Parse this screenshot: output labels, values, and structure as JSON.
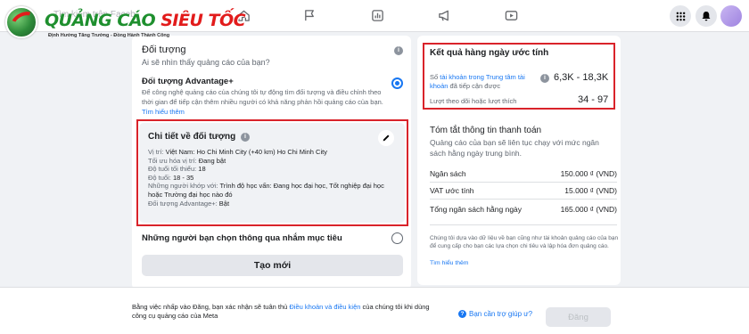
{
  "logo": {
    "text_green": "QUẢNG CÁO ",
    "text_red": "SIÊU TỐC",
    "tagline": "Định Hướng Tăng Trưởng - Đồng Hành Thành Công"
  },
  "search": {
    "placeholder": "Tìm kiếm trên Faceb"
  },
  "left": {
    "section_title": "Đối tượng",
    "section_subtitle": "Ai sẽ nhìn thấy quảng cáo của bạn?",
    "info_glyph": "i",
    "advantage_title": "Đối tượng Advantage+",
    "advantage_desc": "Để công nghệ quảng cáo của chúng tôi tự động tìm đối tượng và điều chỉnh theo thời gian để tiếp cận thêm nhiều người có khả năng phản hồi quảng cáo của bạn.",
    "learn_more": "Tìm hiểu thêm",
    "details": {
      "title": "Chi tiết về đối tượng",
      "location_label": "Vị trí: ",
      "location_value": "Việt Nam: Ho Chi Minh City (+40 km) Ho Chi Minh City",
      "age_opt_label": "Tối ưu hóa vị trí: ",
      "age_opt_value": "Đang bật",
      "min_age_label": "Độ tuổi tối thiểu: ",
      "min_age_value": "18",
      "age_label": "Độ tuổi: ",
      "age_value": "18 - 35",
      "match_label": "Những người khớp với: ",
      "match_value": "Trình độ học vấn: Đang học đại học, Tốt nghiệp đại học hoặc Trường đại học nào đó",
      "adv_label": "Đối tượng Advantage+: ",
      "adv_value": "Bật"
    },
    "friends_option": "Những người bạn chọn thông qua nhắm mục tiêu",
    "create_button": "Tạo mới"
  },
  "right": {
    "results_title": "Kết quả hàng ngày ước tính",
    "reach_label_prefix": "Số ",
    "reach_label_link": "tài khoản trong Trung tâm tài khoản",
    "reach_label_suffix": " đã tiếp cận được",
    "reach_value": "6,3K - 18,3K",
    "likes_label": "Lượt theo dõi hoặc lượt thích",
    "likes_value": "34 - 97",
    "pay_title": "Tóm tắt thông tin thanh toán",
    "pay_desc": "Quảng cáo của bạn sẽ liên tục chạy với mức ngân sách hằng ngày trung bình.",
    "budget_label": "Ngân sách",
    "budget_value": "150.000 ₫ (VND)",
    "vat_label": "VAT ước tính",
    "vat_value": "15.000 ₫ (VND)",
    "total_label": "Tổng ngân sách hằng ngày",
    "total_value": "165.000 ₫ (VND)",
    "note": "Chúng tôi dựa vào dữ liệu về bạn cũng như tài khoản quảng cáo của bạn để cung cấp cho bạn các lựa chọn chi tiêu và lập hóa đơn quảng cáo.",
    "note_link": "Tìm hiểu thêm"
  },
  "bottom": {
    "terms_prefix": "Bằng việc nhấp vào Đăng, bạn xác nhận sẽ tuân thủ ",
    "terms_link": "Điều khoản và điều kiện",
    "terms_suffix": " của chúng tôi khi dùng công cụ quảng cáo của Meta",
    "help_glyph": "?",
    "help": "Bạn cần trợ giúp ư?",
    "publish": "Đăng"
  },
  "colors": {
    "accent": "#1877f2",
    "highlight_frame": "#d9232a",
    "logo_green": "#1e8f2e",
    "logo_red": "#e21b1b"
  },
  "icons": [
    "home-icon",
    "flag-icon",
    "chart-icon",
    "megaphone-icon",
    "video-icon",
    "menu-grid-icon",
    "bell-icon",
    "pencil-icon"
  ]
}
